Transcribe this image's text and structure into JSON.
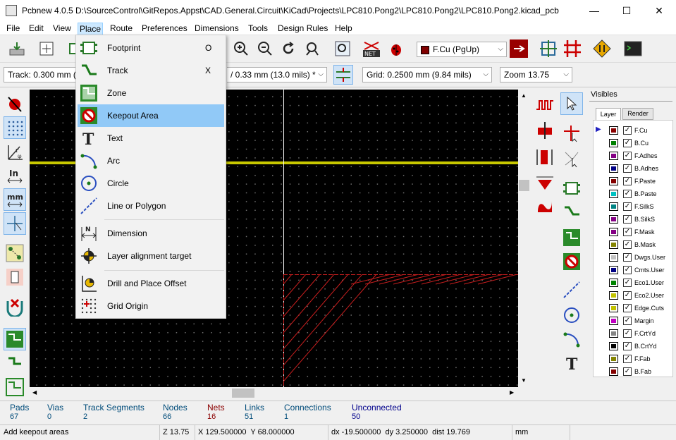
{
  "window": {
    "title": "Pcbnew 4.0.5 D:\\SourceControl\\GitRepos.Appst\\CAD.General.Circuit\\KiCad\\Projects\\LPC810.Pong2\\LPC810.Pong2\\LPC810.Pong2.kicad_pcb",
    "minimize": "—",
    "maximize": "☐",
    "close": "✕"
  },
  "menubar": {
    "items": [
      "File",
      "Edit",
      "View",
      "Place",
      "Route",
      "Preferences",
      "Dimensions",
      "Tools",
      "Design Rules",
      "Help"
    ],
    "active": "Place"
  },
  "toolbar2": {
    "track": "Track: 0.300 mm (",
    "via": "/ 0.33 mm (13.0 mils) *",
    "grid": "Grid: 0.2500 mm (9.84 mils)",
    "zoom": "Zoom 13.75"
  },
  "toolbar1": {
    "layer_select": "F.Cu (PgUp)",
    "layer_color": "#800000"
  },
  "place_menu": {
    "items": [
      {
        "label": "Footprint",
        "shortcut": "O",
        "icon": "footprint-icon"
      },
      {
        "label": "Track",
        "shortcut": "X",
        "icon": "track-icon"
      },
      {
        "label": "Zone",
        "shortcut": "",
        "icon": "zone-icon"
      },
      {
        "label": "Keepout Area",
        "shortcut": "",
        "icon": "keepout-icon"
      },
      {
        "label": "Text",
        "shortcut": "",
        "icon": "text-icon"
      },
      {
        "label": "Arc",
        "shortcut": "",
        "icon": "arc-icon"
      },
      {
        "label": "Circle",
        "shortcut": "",
        "icon": "circle-icon"
      },
      {
        "label": "Line or Polygon",
        "shortcut": "",
        "icon": "line-icon"
      },
      {
        "label": "Dimension",
        "shortcut": "",
        "icon": "dimension-icon"
      },
      {
        "label": "Layer alignment target",
        "shortcut": "",
        "icon": "target-icon"
      },
      {
        "label": "Drill and Place Offset",
        "shortcut": "",
        "icon": "drill-offset-icon"
      },
      {
        "label": "Grid Origin",
        "shortcut": "",
        "icon": "grid-origin-icon"
      }
    ],
    "highlighted": "Keepout Area"
  },
  "visibles": {
    "title": "Visibles",
    "tabs": [
      "Layer",
      "Render"
    ],
    "layers": [
      {
        "name": "F.Cu",
        "color": "#8b0000"
      },
      {
        "name": "B.Cu",
        "color": "#008000"
      },
      {
        "name": "F.Adhes",
        "color": "#840084"
      },
      {
        "name": "B.Adhes",
        "color": "#000084"
      },
      {
        "name": "F.Paste",
        "color": "#840000"
      },
      {
        "name": "B.Paste",
        "color": "#00c2c2"
      },
      {
        "name": "F.SilkS",
        "color": "#008484"
      },
      {
        "name": "B.SilkS",
        "color": "#840084"
      },
      {
        "name": "F.Mask",
        "color": "#840084"
      },
      {
        "name": "B.Mask",
        "color": "#848400"
      },
      {
        "name": "Dwgs.User",
        "color": "#c2c2c2"
      },
      {
        "name": "Cmts.User",
        "color": "#000084"
      },
      {
        "name": "Eco1.User",
        "color": "#008400"
      },
      {
        "name": "Eco2.User",
        "color": "#c2c200"
      },
      {
        "name": "Edge.Cuts",
        "color": "#c2c200"
      },
      {
        "name": "Margin",
        "color": "#c200c2"
      },
      {
        "name": "F.CrtYd",
        "color": "#848484"
      },
      {
        "name": "B.CrtYd",
        "color": "#000000"
      },
      {
        "name": "F.Fab",
        "color": "#848400"
      },
      {
        "name": "B.Fab",
        "color": "#840000"
      }
    ]
  },
  "stats": [
    {
      "label": "Pads",
      "value": "67",
      "color": "#004c7a"
    },
    {
      "label": "Vias",
      "value": "0",
      "color": "#004c7a"
    },
    {
      "label": "Track Segments",
      "value": "2",
      "color": "#004c7a"
    },
    {
      "label": "Nodes",
      "value": "66",
      "color": "#004c7a"
    },
    {
      "label": "Nets",
      "value": "16",
      "color": "#8b0000"
    },
    {
      "label": "Links",
      "value": "51",
      "color": "#004c7a"
    },
    {
      "label": "Connections",
      "value": "1",
      "color": "#004c7a"
    },
    {
      "label": "Unconnected",
      "value": "50",
      "color": "#00008b"
    }
  ],
  "statusbar": {
    "message": "Add keepout areas",
    "zoom": "Z 13.75",
    "xy": "X 129.500000  Y 68.000000",
    "delta": "dx -19.500000  dy 3.250000  dist 19.769",
    "units": "mm"
  }
}
